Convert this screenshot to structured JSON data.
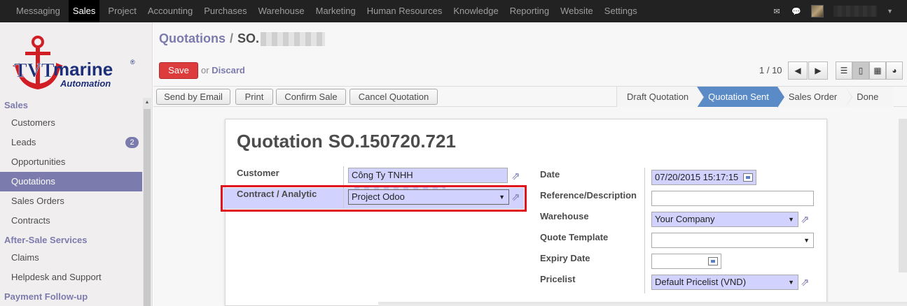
{
  "top_menu": [
    "Messaging",
    "Sales",
    "Project",
    "Accounting",
    "Purchases",
    "Warehouse",
    "Marketing",
    "Human Resources",
    "Knowledge",
    "Reporting",
    "Website",
    "Settings"
  ],
  "top_menu_active": "Sales",
  "logo": {
    "brand": "TVT",
    "brand2": "marine",
    "tagline": "Automation",
    "reg": "®"
  },
  "sidebar": {
    "sections": [
      {
        "title": "Sales",
        "items": [
          {
            "label": "Customers"
          },
          {
            "label": "Leads",
            "badge": "2"
          },
          {
            "label": "Opportunities"
          },
          {
            "label": "Quotations",
            "active": true
          },
          {
            "label": "Sales Orders"
          },
          {
            "label": "Contracts"
          }
        ]
      },
      {
        "title": "After-Sale Services",
        "items": [
          {
            "label": "Claims"
          },
          {
            "label": "Helpdesk and Support"
          }
        ]
      },
      {
        "title": "Payment Follow-up",
        "items": []
      }
    ]
  },
  "breadcrumb": {
    "parent": "Quotations",
    "sep": "/",
    "current": "SO."
  },
  "actions": {
    "save": "Save",
    "or": "or",
    "discard": "Discard"
  },
  "pager": {
    "text": "1 / 10"
  },
  "toolbar": {
    "send_email": "Send by Email",
    "print": "Print",
    "confirm": "Confirm Sale",
    "cancel": "Cancel Quotation"
  },
  "statusbar": [
    "Draft Quotation",
    "Quotation Sent",
    "Sales Order",
    "Done"
  ],
  "statusbar_active": "Quotation Sent",
  "sheet": {
    "title_word": "Quotation",
    "title_number": "SO.150720.721",
    "left_fields": {
      "customer_label": "Customer",
      "customer_value": "Công Ty TNHH",
      "contract_label": "Contract / Analytic",
      "contract_value": "Project Odoo"
    },
    "right_fields": {
      "date_label": "Date",
      "date_value": "07/20/2015 15:17:15",
      "ref_label": "Reference/Description",
      "ref_value": "",
      "warehouse_label": "Warehouse",
      "warehouse_value": "Your Company",
      "template_label": "Quote Template",
      "template_value": "",
      "expiry_label": "Expiry Date",
      "expiry_value": "",
      "pricelist_label": "Pricelist",
      "pricelist_value": "Default Pricelist (VND)"
    }
  },
  "colors": {
    "accent": "#7c7bad",
    "save": "#dc3c3c",
    "status_active": "#5b8bc6",
    "highlight": "#e0131f",
    "required": "#d2d2ff"
  }
}
